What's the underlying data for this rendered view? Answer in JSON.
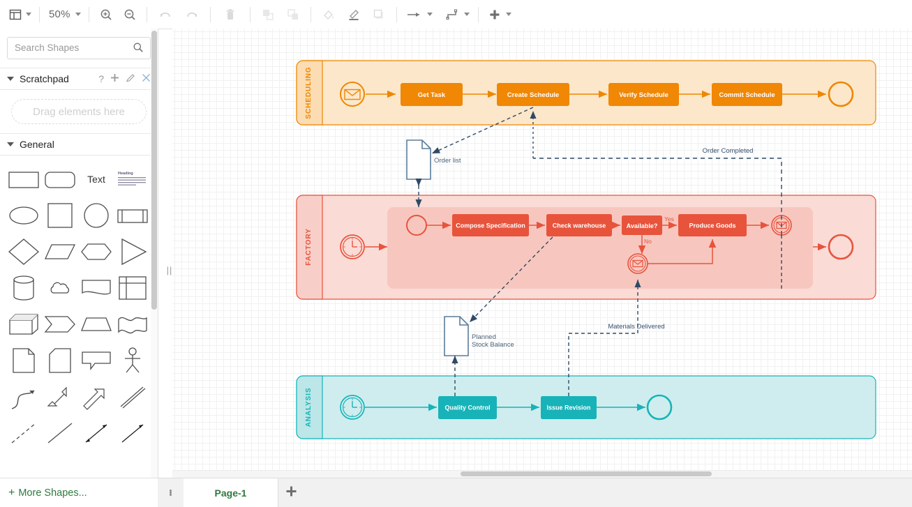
{
  "toolbar": {
    "view_icon": "layout-panel-icon",
    "zoom_level": "50%",
    "zoom_in_icon": "zoom-in-icon",
    "zoom_out_icon": "zoom-out-icon",
    "undo_icon": "undo-icon",
    "redo_icon": "redo-icon",
    "delete_icon": "trash-icon",
    "to_front_icon": "bring-to-front-icon",
    "to_back_icon": "send-to-back-icon",
    "fill_icon": "fill-color-icon",
    "line_icon": "line-color-icon",
    "shadow_icon": "shadow-icon",
    "connection_icon": "connection-arrow-icon",
    "waypoints_icon": "waypoints-icon",
    "insert_icon": "plus-icon"
  },
  "sidebar": {
    "search": {
      "placeholder": "Search Shapes",
      "value": ""
    },
    "scratchpad": {
      "title": "Scratchpad",
      "help_icon": "help-icon",
      "add_icon": "plus-icon",
      "edit_icon": "pencil-icon",
      "close_icon": "close-icon",
      "drop_hint": "Drag elements here"
    },
    "general": {
      "title": "General",
      "shapes": [
        [
          "rectangle-shape",
          "rounded-rectangle-shape",
          "text-shape",
          "textbox-shape"
        ],
        [
          "ellipse-shape",
          "square-shape",
          "circle-shape",
          "process-shape"
        ],
        [
          "diamond-shape",
          "parallelogram-shape",
          "hexagon-shape",
          "triangle-shape"
        ],
        [
          "cylinder-shape",
          "cloud-shape",
          "document-shape",
          "internal-storage-shape"
        ],
        [
          "cube-shape",
          "step-shape",
          "trapezoid-shape",
          "tape-shape"
        ],
        [
          "note-shape",
          "card-shape",
          "callout-shape",
          "actor-shape"
        ],
        [
          "curved-arrow-shape",
          "bidirectional-arrow-shape",
          "arrow-shape",
          "double-line-shape"
        ],
        [
          "dashed-line-shape",
          "line-shape",
          "bidirectional-connector-shape",
          "directional-connector-shape"
        ]
      ],
      "text_label": "Text",
      "textbox_heading": "Heading"
    },
    "more_shapes": "More Shapes..."
  },
  "footer": {
    "page_menu_icon": "vertical-dots-icon",
    "page_tab": "Page-1",
    "add_page_icon": "plus-icon"
  },
  "diagram": {
    "lanes": [
      {
        "name": "SCHEDULING",
        "color": "#EE8700",
        "fill": "#FCE7CB",
        "header_fill": "#FBDCB3"
      },
      {
        "name": "FACTORY",
        "color": "#E8533C",
        "fill": "#FADBD6",
        "header_fill": "#F8CFC8"
      },
      {
        "name": "ANALYSIS",
        "color": "#17B3B8",
        "fill": "#CFEDEE",
        "header_fill": "#BCE6E7"
      }
    ],
    "scheduling": {
      "start_event": "message-start-event",
      "tasks": [
        "Get Task",
        "Create Schedule",
        "Verify Schedule",
        "Commit Schedule"
      ],
      "end_event": "end-event"
    },
    "factory": {
      "timer_event": "timer-start-event",
      "start_event": "start-event",
      "tasks": [
        "Compose Specification",
        "Check warehouse",
        "Produce Goods"
      ],
      "gateway": "Available?",
      "gateway_yes": "Yes",
      "gateway_no": "No",
      "intermediate_catch": "message-catch-event",
      "intermediate_throw": "message-throw-event",
      "end_event": "end-event"
    },
    "analysis": {
      "timer_event": "timer-start-event",
      "tasks": [
        "Quality Control",
        "Issue Revision"
      ],
      "end_event": "end-event"
    },
    "artifacts": [
      {
        "name": "Order list",
        "lines": [
          "Order list"
        ]
      },
      {
        "name": "Planned Stock Balance",
        "lines": [
          "Planned",
          "Stock Balance"
        ]
      }
    ],
    "flow_labels": [
      "Order Completed",
      "Materials Delivered"
    ]
  }
}
